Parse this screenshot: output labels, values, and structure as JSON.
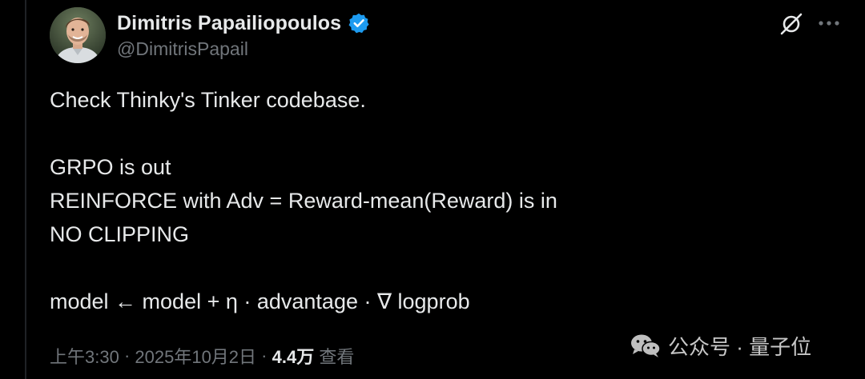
{
  "author": {
    "display_name": "Dimitris Papailiopoulos",
    "handle": "@DimitrisPapail",
    "verified_icon": "verified-badge-icon",
    "verified_color": "#1d9bf0"
  },
  "header_actions": {
    "grok_icon": "grok-icon",
    "more_icon": "more-options-icon"
  },
  "tweet": {
    "lines": [
      "Check Thinky's Tinker codebase.",
      "GRPO is out",
      "REINFORCE with Adv = Reward-mean(Reward) is in",
      "NO CLIPPING",
      "model ← model + η · advantage · ∇ logprob"
    ]
  },
  "meta": {
    "time": "上午3:30",
    "separator": " · ",
    "date": "2025年10月2日",
    "views_count": "4.4万",
    "views_label": " 查看"
  },
  "watermark": {
    "icon": "wechat-icon",
    "text": "公众号 · 量子位"
  },
  "colors": {
    "background": "#000000",
    "primary_text": "#e7e9ea",
    "secondary_text": "#71767b"
  }
}
